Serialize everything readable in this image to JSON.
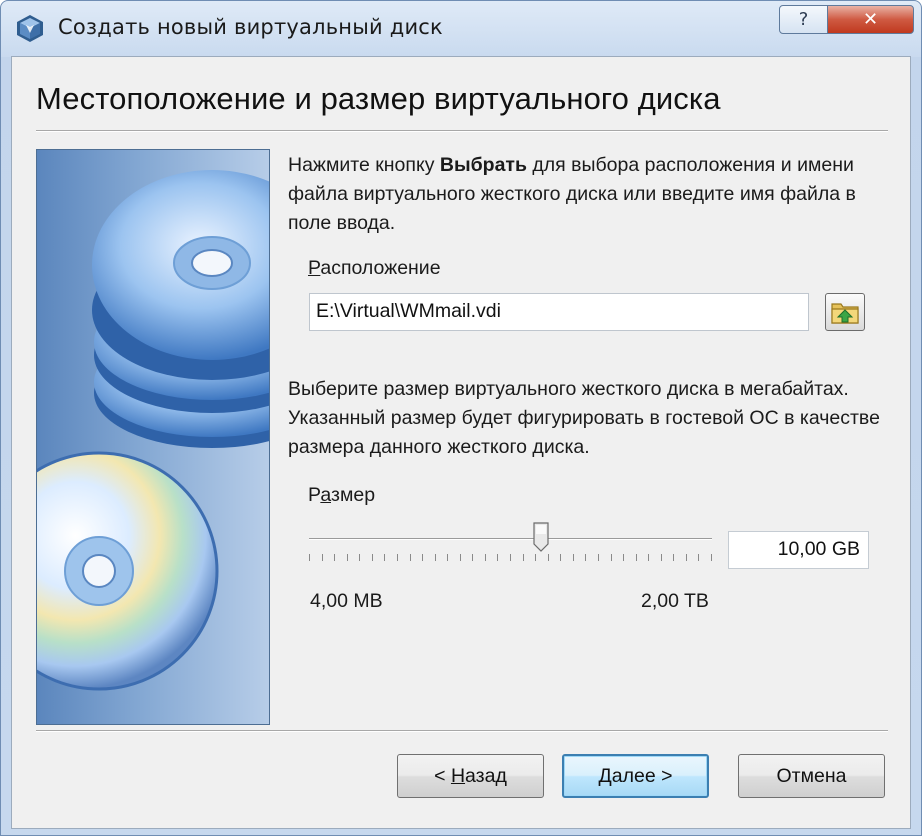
{
  "window": {
    "title": "Создать новый виртуальный диск",
    "help_label": "?",
    "close_label": "✕"
  },
  "page": {
    "title": "Местоположение и размер виртуального диска"
  },
  "intro": {
    "prefix": "Нажмите кнопку ",
    "bold": "Выбрать",
    "suffix": " для выбора расположения и имени файла виртуального жесткого диска или введите имя файла в поле ввода."
  },
  "location": {
    "label_underlined": "Р",
    "label_rest": "асположение",
    "value": "E:\\Virtual\\WMmail.vdi",
    "browse_icon": "folder-up-icon"
  },
  "size": {
    "description": "Выберите размер виртуального жесткого диска в мегабайтах. Указанный размер будет фигурировать в гостевой ОС в качестве размера данного жесткого диска.",
    "label_first": "Р",
    "label_underlined": "а",
    "label_rest": "змер",
    "value": "10,00 GB",
    "min_label": "4,00 MB",
    "max_label": "2,00 TB",
    "slider_position_fraction": 0.58
  },
  "buttons": {
    "back_prefix": "< ",
    "back_underlined": "Н",
    "back_rest": "азад",
    "next_underlined": "Д",
    "next_rest": "алее >",
    "cancel": "Отмена"
  },
  "colors": {
    "accent": "#3c7fb1",
    "side_panel": "#6f98cb"
  }
}
